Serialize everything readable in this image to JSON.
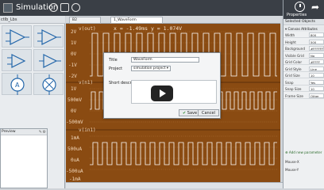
{
  "app": {
    "title": "Simulation"
  },
  "library": {
    "title": "ctIb_Lbs"
  },
  "left_lower": {
    "title": "Preview"
  },
  "tabs": [
    {
      "label": "B2"
    },
    {
      "label": "1_WaveForm"
    }
  ],
  "scope": {
    "readout": "x = -1.49ms  y = 1.074V",
    "label_top": "v(out)",
    "label_mid": "v(n1)",
    "label_bot": "v(in1)",
    "ticks_ch1": [
      "2V",
      "1V",
      "0V",
      "-1V",
      "-2V"
    ],
    "ticks_ch2": [
      "1V",
      "500mV",
      "0V",
      "-500mV"
    ],
    "ticks_ch3": [
      "1mA",
      "500uA",
      "0uA",
      "-500uA",
      "-1mA"
    ]
  },
  "dialog": {
    "title_label": "Title",
    "title_value": "WaveForm",
    "project_label": "Project",
    "project_value": "simulation project",
    "desc_label": "Short descript",
    "save_label": "Save",
    "cancel_label": "Cancel"
  },
  "properties": {
    "header": "Properties",
    "selected": "Selected Objects",
    "section": "Canvas Attributes",
    "rows": [
      {
        "name": "Width",
        "value": "800"
      },
      {
        "name": "Height",
        "value": "500"
      },
      {
        "name": "Background",
        "value": "#FFFFFF"
      },
      {
        "name": "Visible Grid",
        "value": "No"
      },
      {
        "name": "Grid Color",
        "value": "#FFFF"
      },
      {
        "name": "Grid Style",
        "value": "Line"
      },
      {
        "name": "Grid Size",
        "value": "10"
      },
      {
        "name": "Snap",
        "value": "Yes"
      },
      {
        "name": "Snap Size",
        "value": "10"
      },
      {
        "name": "Frame Size",
        "value": "Other"
      }
    ],
    "add_param": "Add new parameter",
    "mouse_x": "Mouse-X",
    "mouse_y": "Mouse-Y"
  },
  "colors": {
    "canvas": "#8a4b12",
    "trace": "#ffffff",
    "accent": "#3a3f46"
  }
}
